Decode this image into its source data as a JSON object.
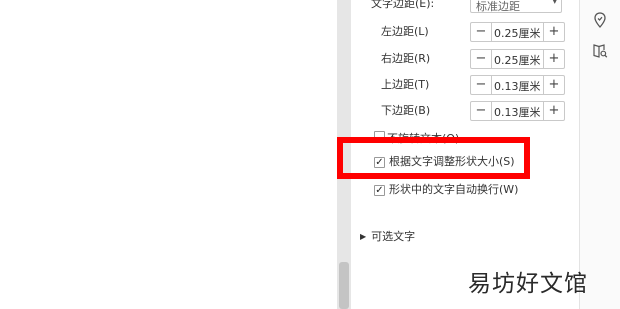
{
  "text_box": {
    "margin_label": "文字边距(E):",
    "margin_preset": "标准边距",
    "spinners": [
      {
        "label": "左边距(L)",
        "value": "0.25厘米"
      },
      {
        "label": "右边距(R)",
        "value": "0.25厘米"
      },
      {
        "label": "上边距(T)",
        "value": "0.13厘米"
      },
      {
        "label": "下边距(B)",
        "value": "0.13厘米"
      }
    ],
    "minus_glyph": "−",
    "plus_glyph": "+",
    "checkboxes": [
      {
        "label": "不旋转文本(O)",
        "checked": false
      },
      {
        "label": "根据文字调整形状大小(S)",
        "checked": true
      },
      {
        "label": "形状中的文字自动换行(W)",
        "checked": true
      }
    ],
    "optional_text_label": "可选文字"
  },
  "right_rail": {
    "icons": [
      "location-pin-icon",
      "book-search-icon"
    ]
  },
  "watermark": "易坊好文馆",
  "colors": {
    "highlight": "#ff0000",
    "border": "#c9c9c9"
  }
}
